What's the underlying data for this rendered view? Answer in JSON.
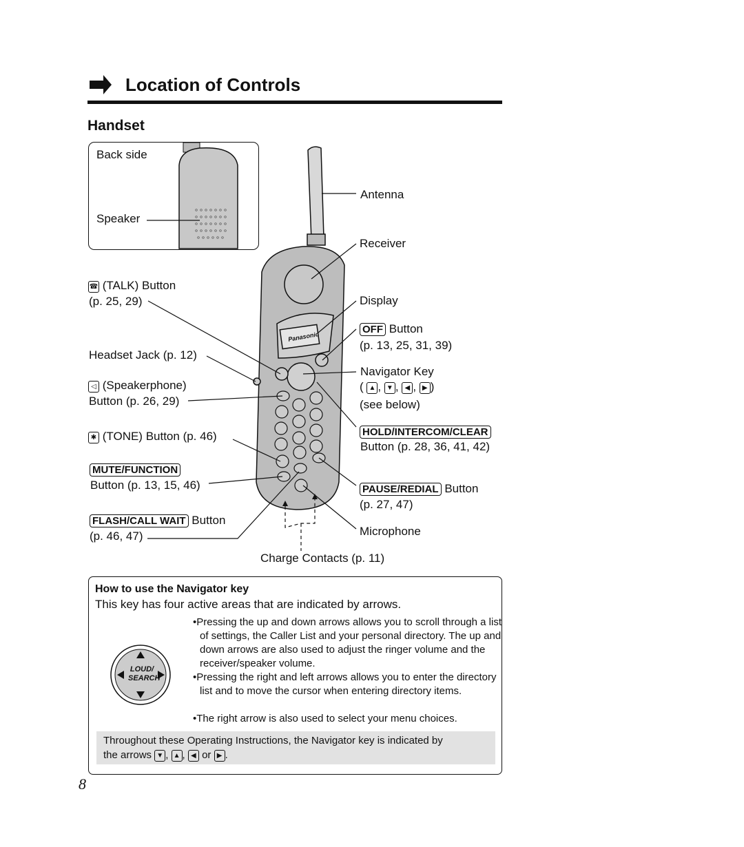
{
  "header": {
    "title": "Location of Controls",
    "icon": "right-arrow-icon"
  },
  "section": "Handset",
  "back_side": {
    "title": "Back side",
    "speaker": "Speaker"
  },
  "labels": {
    "antenna": "Antenna",
    "receiver": "Receiver",
    "display": "Display",
    "off_key": "OFF",
    "off_text": "Button",
    "off_pages": "(p. 13, 25, 31, 39)",
    "navigator": "Navigator Key",
    "navigator_open": "(",
    "navigator_close": ")",
    "navigator_see": "(see below)",
    "hold_key": "HOLD/INTERCOM/CLEAR",
    "hold_pages": "Button (p. 28, 36, 41, 42)",
    "pause_key": "PAUSE/REDIAL",
    "pause_text": "Button",
    "pause_pages": "(p. 27, 47)",
    "microphone": "Microphone",
    "charge": "Charge Contacts (p. 11)",
    "talk": "(TALK) Button",
    "talk_pages": "(p. 25, 29)",
    "headset": "Headset Jack (p. 12)",
    "speakerphone": "(Speakerphone)",
    "speakerphone_pages": "Button (p. 26, 29)",
    "tone": "(TONE) Button (p. 46)",
    "mute_key": "MUTE/FUNCTION",
    "mute_pages": "Button (p. 13, 15, 46)",
    "flash_key": "FLASH/CALL WAIT",
    "flash_text": "Button",
    "flash_pages": "(p. 46, 47)"
  },
  "phone": {
    "brand": "Panasonic"
  },
  "navigator_help": {
    "heading": "How to use the Navigator key",
    "intro": "This key has four active areas that are indicated by arrows.",
    "key_label_1": "LOUD/",
    "key_label_2": "SEARCH",
    "bullets": [
      "Pressing the up and down arrows allows you to scroll through a list of settings, the Caller List and your personal directory. The up and down arrows are also used to adjust the ringer volume and the receiver/speaker volume.",
      "Pressing the right and left arrows allows you to enter the directory list and to move the cursor when entering directory items.",
      "The right arrow is also used to select your menu choices."
    ],
    "note_1": "Throughout these Operating Instructions, the Navigator key is indicated by",
    "note_2": "the arrows",
    "note_or": "or"
  },
  "page_number": "8"
}
